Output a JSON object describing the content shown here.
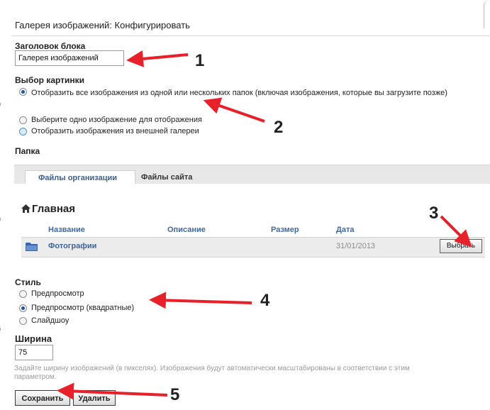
{
  "page": {
    "title": "Галерея изображений: Конфигурировать"
  },
  "block_title": {
    "label": "Заголовок блока",
    "value": "Галерея изображений"
  },
  "image_choice": {
    "label": "Выбор картинки",
    "options": [
      {
        "label": "Отобразить все изображения из одной или нескольких папок (включая изображения, которые вы загрузите позже)",
        "checked": true
      },
      {
        "label": "Выберите одно изображение для отображения",
        "checked": false
      },
      {
        "label": "Отобразить изображения из внешней галереи",
        "checked": false
      }
    ]
  },
  "folder": {
    "label": "Папка",
    "tabs": [
      {
        "label": "Файлы организации",
        "active": true
      },
      {
        "label": "Файлы сайта",
        "active": false
      }
    ],
    "home_title": "Главная",
    "columns": [
      "Название",
      "Описание",
      "Размер",
      "Дата"
    ],
    "rows": [
      {
        "name": "Фотографии",
        "description": "",
        "size": "",
        "date": "31/01/2013",
        "action": "Выбрать"
      }
    ]
  },
  "style": {
    "label": "Стиль",
    "options": [
      {
        "label": "Предпросмотр",
        "checked": false
      },
      {
        "label": "Предпросмотр (квадратные)",
        "checked": true
      },
      {
        "label": "Слайдшоу",
        "checked": false
      }
    ]
  },
  "width": {
    "label": "Ширина",
    "value": "75",
    "help": "Задайте ширину изображений (в пикселях). Изображения будут автоматически масштабированы в соответствии с этим параметром."
  },
  "buttons": {
    "save": "Сохранить",
    "delete": "Удалить"
  },
  "annotations": {
    "color": "#e8202a",
    "numbers": [
      "1",
      "2",
      "3",
      "4",
      "5"
    ]
  }
}
